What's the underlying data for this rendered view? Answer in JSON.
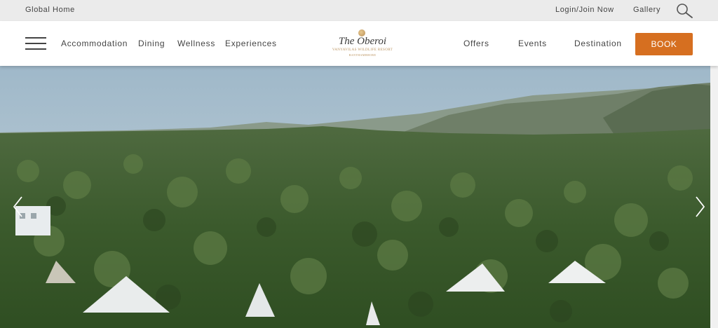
{
  "topbar": {
    "global_home": "Global Home",
    "login": "Login/Join Now",
    "gallery": "Gallery",
    "search_icon": "search-icon"
  },
  "navbar": {
    "menu_icon": "hamburger-menu-icon",
    "left_links": [
      "Accommodation",
      "Dining",
      "Wellness",
      "Experiences"
    ],
    "right_links": [
      "Offers",
      "Events",
      "Destination"
    ],
    "book_label": "BOOK"
  },
  "logo": {
    "name": "The Oberoi",
    "subtitle": "VANYAVILAS WILDLIFE RESORT",
    "location": "RANTHAMBHORE"
  },
  "hero": {
    "prev_icon": "chevron-left-icon",
    "next_icon": "chevron-right-icon"
  },
  "colors": {
    "topbar_bg": "#ebebeb",
    "accent": "#d66f20",
    "logo_gold": "#b8905a"
  }
}
